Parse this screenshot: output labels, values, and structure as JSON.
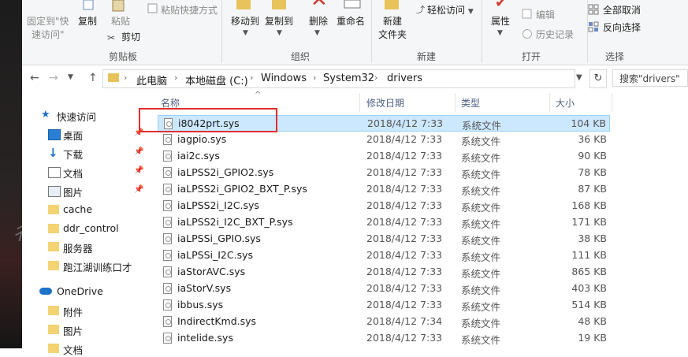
{
  "ribbon": {
    "pin_quick_access": "固定到\"快",
    "pin_quick_access2": "速访问\"",
    "copy": "复制",
    "paste": "粘贴",
    "paste_shortcut": "粘贴快捷方式",
    "cut": "剪切",
    "clipboard_group": "剪贴板",
    "move_to": "移动到",
    "copy_to": "复制到",
    "delete": "删除",
    "rename": "重命名",
    "organize_group": "组织",
    "new_folder": "新建",
    "new_folder2": "文件夹",
    "easy_access": "轻松访问",
    "new_group": "新建",
    "properties": "属性",
    "edit": "编辑",
    "history": "历史记录",
    "open_group": "打开",
    "select_none": "全部取消",
    "invert_selection": "反向选择",
    "select_group": "选择"
  },
  "address": {
    "crumbs": [
      "此电脑",
      "本地磁盘 (C:)",
      "Windows",
      "System32",
      "drivers"
    ],
    "search_placeholder": "搜索\"drivers\""
  },
  "nav": {
    "quick_access": "快速访问",
    "items": [
      "桌面",
      "下载",
      "文档",
      "图片",
      "cache",
      "ddr_control",
      "服务器",
      "跑江湖训练口才"
    ],
    "onedrive": "OneDrive",
    "onedrive_items": [
      "附件",
      "图片",
      "文档"
    ]
  },
  "columns": {
    "name": "名称",
    "date": "修改日期",
    "type": "类型",
    "size": "大小"
  },
  "files": [
    {
      "name": "i8042prt.sys",
      "date": "2018/4/12 7:33",
      "type": "系统文件",
      "size": "104 KB"
    },
    {
      "name": "iagpio.sys",
      "date": "2018/4/12 7:33",
      "type": "系统文件",
      "size": "36 KB"
    },
    {
      "name": "iai2c.sys",
      "date": "2018/4/12 7:33",
      "type": "系统文件",
      "size": "90 KB"
    },
    {
      "name": "iaLPSS2i_GPIO2.sys",
      "date": "2018/4/12 7:33",
      "type": "系统文件",
      "size": "78 KB"
    },
    {
      "name": "iaLPSS2i_GPIO2_BXT_P.sys",
      "date": "2018/4/12 7:33",
      "type": "系统文件",
      "size": "87 KB"
    },
    {
      "name": "iaLPSS2i_I2C.sys",
      "date": "2018/4/12 7:33",
      "type": "系统文件",
      "size": "168 KB"
    },
    {
      "name": "iaLPSS2i_I2C_BXT_P.sys",
      "date": "2018/4/12 7:33",
      "type": "系统文件",
      "size": "171 KB"
    },
    {
      "name": "iaLPSSi_GPIO.sys",
      "date": "2018/4/12 7:33",
      "type": "系统文件",
      "size": "38 KB"
    },
    {
      "name": "iaLPSSi_I2C.sys",
      "date": "2018/4/12 7:33",
      "type": "系统文件",
      "size": "111 KB"
    },
    {
      "name": "iaStorAVC.sys",
      "date": "2018/4/12 7:33",
      "type": "系统文件",
      "size": "865 KB"
    },
    {
      "name": "iaStorV.sys",
      "date": "2018/4/12 7:33",
      "type": "系统文件",
      "size": "403 KB"
    },
    {
      "name": "ibbus.sys",
      "date": "2018/4/12 7:33",
      "type": "系统文件",
      "size": "514 KB"
    },
    {
      "name": "IndirectKmd.sys",
      "date": "2018/4/12 7:34",
      "type": "系统文件",
      "size": "48 KB"
    },
    {
      "name": "intelide.sys",
      "date": "2018/4/12 7:33",
      "type": "系统文件",
      "size": "19 KB"
    }
  ],
  "colors": {
    "selection": "#cce8ff",
    "highlight_box": "#e0302f",
    "folder": "#e8c25a",
    "accent_blue": "#1e73c8"
  }
}
